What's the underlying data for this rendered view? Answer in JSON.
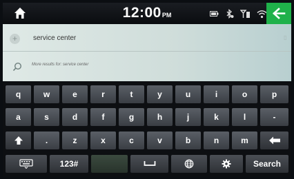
{
  "status_bar": {
    "time": "12:00",
    "ampm": "PM",
    "icons": [
      "home-icon",
      "battery-icon",
      "bluetooth-icon",
      "signal-icon",
      "wifi-icon",
      "back-arrow-icon"
    ],
    "colors": {
      "back_button": "#1fb14a"
    }
  },
  "search": {
    "query": "service center",
    "more_results": "More results for: service center"
  },
  "keyboard": {
    "row1": [
      "q",
      "w",
      "e",
      "r",
      "t",
      "y",
      "u",
      "i",
      "o",
      "p"
    ],
    "row2": [
      "a",
      "s",
      "d",
      "f",
      "g",
      "h",
      "j",
      "k",
      "l",
      "-"
    ],
    "row3": [
      ".",
      "z",
      "x",
      "c",
      "v",
      "b",
      "n",
      "m"
    ],
    "symbols_label": "123#",
    "search_label": "Search",
    "icons": [
      "shift-icon",
      "backspace-icon",
      "keyboard-icon",
      "space-icon",
      "globe-icon",
      "gear-icon"
    ]
  }
}
